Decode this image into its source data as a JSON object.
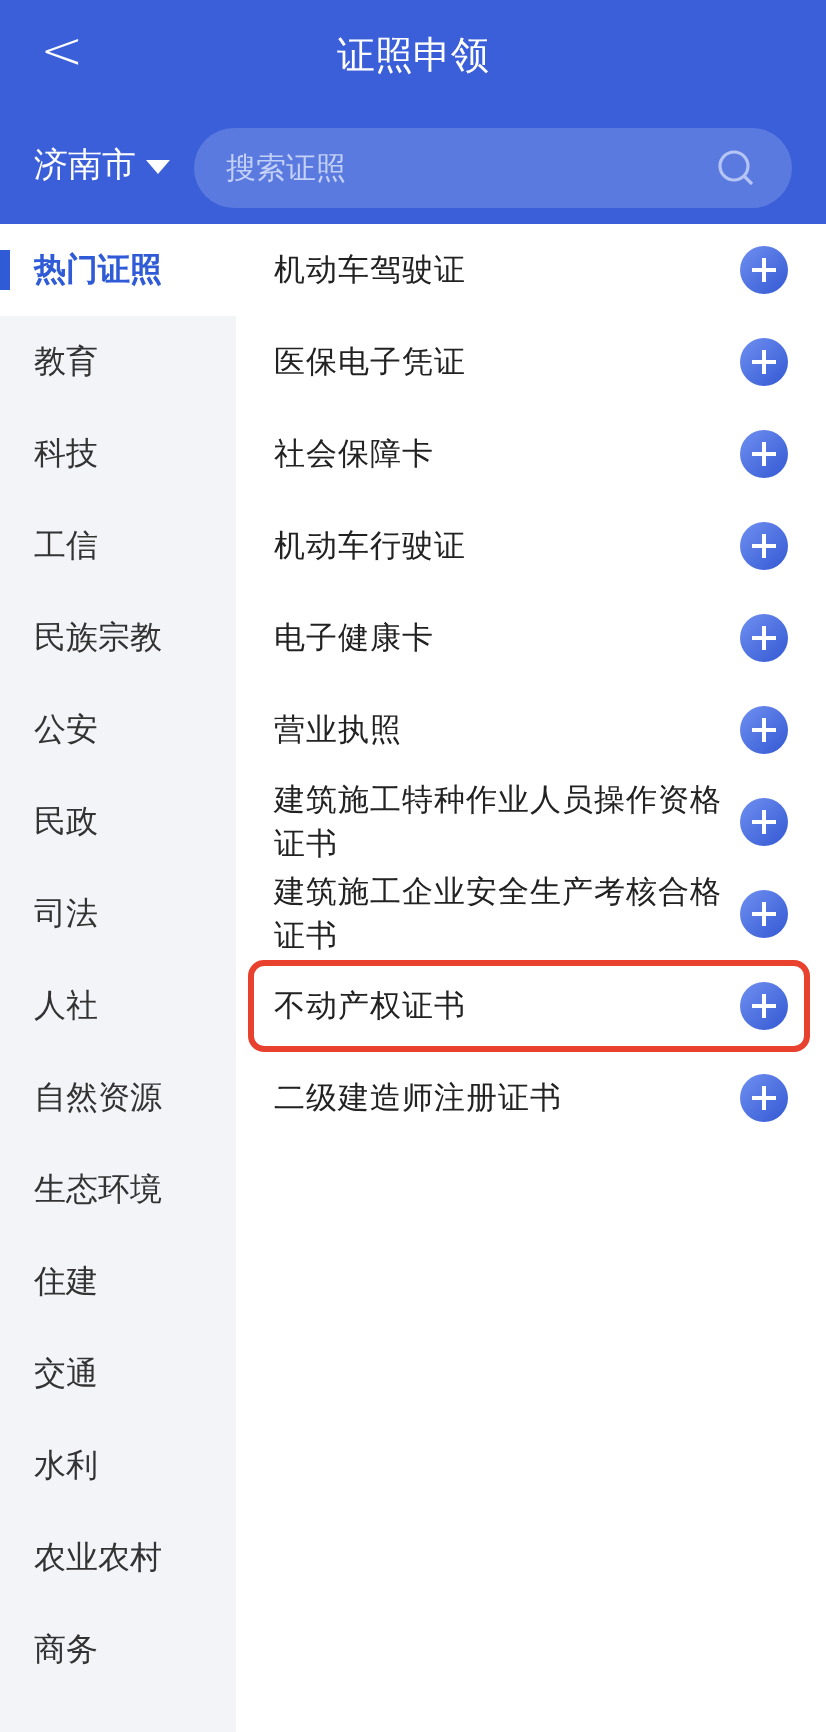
{
  "header": {
    "back": "<",
    "title": "证照申领"
  },
  "city": {
    "label": "济南市"
  },
  "search": {
    "placeholder": "搜索证照"
  },
  "categories": [
    {
      "label": "热门证照",
      "selected": true
    },
    {
      "label": "教育",
      "selected": false
    },
    {
      "label": "科技",
      "selected": false
    },
    {
      "label": "工信",
      "selected": false
    },
    {
      "label": "民族宗教",
      "selected": false
    },
    {
      "label": "公安",
      "selected": false
    },
    {
      "label": "民政",
      "selected": false
    },
    {
      "label": "司法",
      "selected": false
    },
    {
      "label": "人社",
      "selected": false
    },
    {
      "label": "自然资源",
      "selected": false
    },
    {
      "label": "生态环境",
      "selected": false
    },
    {
      "label": "住建",
      "selected": false
    },
    {
      "label": "交通",
      "selected": false
    },
    {
      "label": "水利",
      "selected": false
    },
    {
      "label": "农业农村",
      "selected": false
    },
    {
      "label": "商务",
      "selected": false
    }
  ],
  "licenses": [
    {
      "name": "机动车驾驶证",
      "highlighted": false
    },
    {
      "name": "医保电子凭证",
      "highlighted": false
    },
    {
      "name": "社会保障卡",
      "highlighted": false
    },
    {
      "name": "机动车行驶证",
      "highlighted": false
    },
    {
      "name": "电子健康卡",
      "highlighted": false
    },
    {
      "name": "营业执照",
      "highlighted": false
    },
    {
      "name": "建筑施工特种作业人员操作资格证书",
      "highlighted": false
    },
    {
      "name": "建筑施工企业安全生产考核合格证书",
      "highlighted": false
    },
    {
      "name": "不动产权证书",
      "highlighted": true
    },
    {
      "name": "二级建造师注册证书",
      "highlighted": false
    }
  ]
}
